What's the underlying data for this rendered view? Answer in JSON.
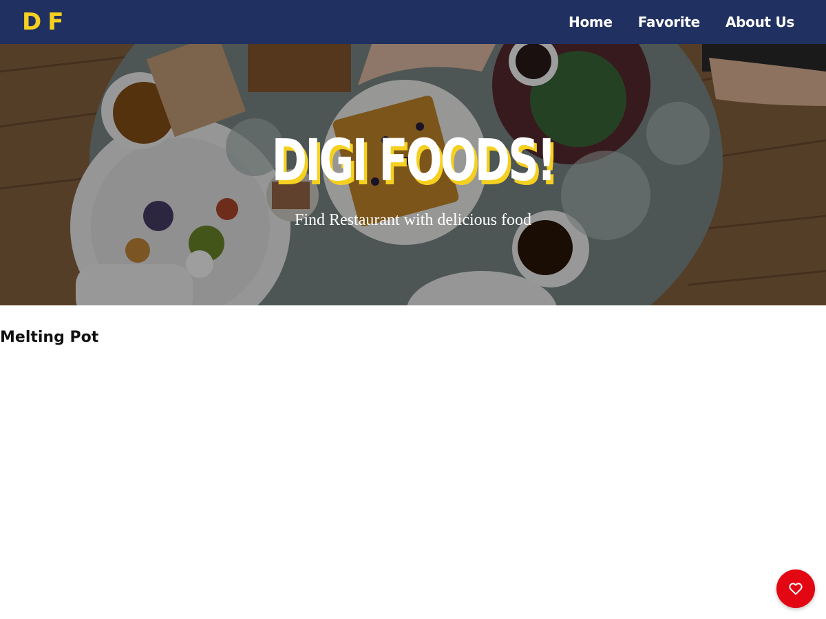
{
  "navbar": {
    "brand": "DF",
    "links": [
      {
        "label": "Home"
      },
      {
        "label": "Favorite"
      },
      {
        "label": "About Us"
      }
    ]
  },
  "hero": {
    "title": "DIGI FOODS!",
    "subtitle": "Find Restaurant with delicious food"
  },
  "main": {
    "section_title": "Melting Pot"
  },
  "fab": {
    "icon": "heart-icon",
    "color": "#e30613"
  },
  "colors": {
    "navbar": "#203060",
    "accent": "#f5d020"
  }
}
